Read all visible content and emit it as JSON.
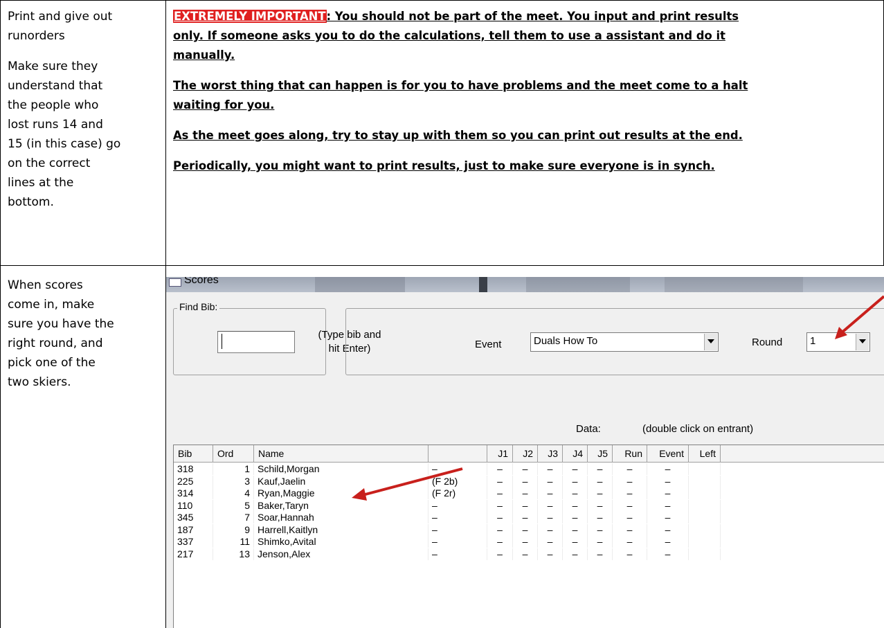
{
  "row1": {
    "left_lines": [
      "Print and give out",
      "runorders",
      "Make sure they",
      "understand that",
      "the people who",
      "lost runs 14 and",
      "15 (in this case) go",
      "on the correct",
      "lines at the",
      "bottom."
    ],
    "important_label": "EXTREMELY IMPORTANT",
    "para1_rest_line1": ": You should not be part of the meet. You input and print results",
    "para1_line2": "only. If someone asks you to do the calculations, tell them to use a assistant and do it",
    "para1_line3": "manually.",
    "para2_line1": "The worst thing that can happen is for you to have problems and the meet come to a halt",
    "para2_line2": "waiting for you.",
    "para3": "As the meet goes along, try to stay up with them so you can print out results at the end.",
    "para4": "Periodically, you might want to print results, just to make sure everyone is in synch."
  },
  "row2": {
    "left_lines": [
      "When scores",
      "come in, make",
      "sure you have the",
      "right round, and",
      "pick one of the",
      "two skiers."
    ]
  },
  "scores_window": {
    "title": "Scores",
    "find_bib_legend": "Find Bib:",
    "find_bib_value": "",
    "find_bib_hint_line1": "(Type bib and",
    "find_bib_hint_line2": "hit Enter)",
    "event_label": "Event",
    "event_value": "Duals How To",
    "round_label": "Round",
    "round_value": "1",
    "data_label": "Data:",
    "data_hint": "(double click on entrant)",
    "columns": [
      "Bib",
      "Ord",
      "Name",
      "",
      "J1",
      "J2",
      "J3",
      "J4",
      "J5",
      "Run",
      "Event",
      "Left"
    ],
    "rows": [
      {
        "bib": "318",
        "ord": "1",
        "name": "Schild,Morgan",
        "flag": "–"
      },
      {
        "bib": "225",
        "ord": "3",
        "name": "Kauf,Jaelin",
        "flag": "(F 2b)"
      },
      {
        "bib": "314",
        "ord": "4",
        "name": "Ryan,Maggie",
        "flag": "(F 2r)"
      },
      {
        "bib": "110",
        "ord": "5",
        "name": "Baker,Taryn",
        "flag": "–"
      },
      {
        "bib": "345",
        "ord": "7",
        "name": "Soar,Hannah",
        "flag": "–"
      },
      {
        "bib": "187",
        "ord": "9",
        "name": "Harrell,Kaitlyn",
        "flag": "–"
      },
      {
        "bib": "337",
        "ord": "11",
        "name": "Shimko,Avital",
        "flag": "–"
      },
      {
        "bib": "217",
        "ord": "13",
        "name": "Jenson,Alex",
        "flag": "–"
      }
    ],
    "dash": "–"
  }
}
